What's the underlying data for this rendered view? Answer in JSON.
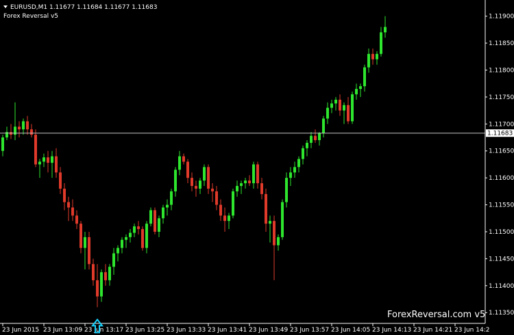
{
  "header": {
    "symbol_line": "EURUSD,M1  1.11677 1.11684 1.11677 1.11683",
    "indicator": "Forex Reversal v5"
  },
  "watermark": "ForexReversal.com v5",
  "colors": {
    "background": "#000000",
    "bull": "#2ee62e",
    "bear": "#e03a2a",
    "axis": "#ffffff",
    "arrow": "#19d3ff",
    "price_line": "#c8c8c8"
  },
  "chart_data": {
    "type": "candlestick",
    "symbol": "EURUSD",
    "timeframe": "M1",
    "ylim": [
      1.1133,
      1.1193
    ],
    "y_ticks": [
      "1.11900",
      "1.11850",
      "1.11800",
      "1.11750",
      "1.11700",
      "1.11650",
      "1.11600",
      "1.11550",
      "1.11500",
      "1.11450",
      "1.11400",
      "1.11350"
    ],
    "current_price": "1.11683",
    "x_labels": [
      "23 Jun 2015",
      "23 Jun 13:09",
      "23 Jun 13:17",
      "23 Jun 13:25",
      "23 Jun 13:33",
      "23 Jun 13:41",
      "23 Jun 13:49",
      "23 Jun 13:57",
      "23 Jun 14:05",
      "23 Jun 14:13",
      "23 Jun 14:21",
      "23 Jun 14:2"
    ],
    "x_label_candle_index": [
      0,
      10,
      20,
      30,
      40,
      50,
      60,
      70,
      80,
      90,
      100,
      110
    ],
    "candles": [
      {
        "o": 1.1165,
        "h": 1.1168,
        "l": 1.1164,
        "c": 1.11675
      },
      {
        "o": 1.11675,
        "h": 1.11695,
        "l": 1.1167,
        "c": 1.11685
      },
      {
        "o": 1.11685,
        "h": 1.117,
        "l": 1.11672,
        "c": 1.1168
      },
      {
        "o": 1.1168,
        "h": 1.1174,
        "l": 1.1167,
        "c": 1.11695
      },
      {
        "o": 1.11695,
        "h": 1.11705,
        "l": 1.11675,
        "c": 1.1169
      },
      {
        "o": 1.1169,
        "h": 1.1171,
        "l": 1.1168,
        "c": 1.11705
      },
      {
        "o": 1.11705,
        "h": 1.11715,
        "l": 1.1168,
        "c": 1.1169
      },
      {
        "o": 1.1169,
        "h": 1.117,
        "l": 1.11675,
        "c": 1.1168
      },
      {
        "o": 1.1168,
        "h": 1.1169,
        "l": 1.1162,
        "c": 1.11625
      },
      {
        "o": 1.11625,
        "h": 1.11635,
        "l": 1.116,
        "c": 1.1163
      },
      {
        "o": 1.1163,
        "h": 1.11645,
        "l": 1.1162,
        "c": 1.11638
      },
      {
        "o": 1.11638,
        "h": 1.1165,
        "l": 1.1161,
        "c": 1.11628
      },
      {
        "o": 1.11628,
        "h": 1.1165,
        "l": 1.116,
        "c": 1.1164
      },
      {
        "o": 1.1164,
        "h": 1.11655,
        "l": 1.116,
        "c": 1.1161
      },
      {
        "o": 1.1161,
        "h": 1.1162,
        "l": 1.1157,
        "c": 1.1158
      },
      {
        "o": 1.1158,
        "h": 1.1159,
        "l": 1.1154,
        "c": 1.11555
      },
      {
        "o": 1.11555,
        "h": 1.11565,
        "l": 1.1152,
        "c": 1.11545
      },
      {
        "o": 1.11545,
        "h": 1.1156,
        "l": 1.1152,
        "c": 1.1153
      },
      {
        "o": 1.1153,
        "h": 1.1154,
        "l": 1.11505,
        "c": 1.11515
      },
      {
        "o": 1.11515,
        "h": 1.1152,
        "l": 1.1146,
        "c": 1.1147
      },
      {
        "o": 1.1147,
        "h": 1.115,
        "l": 1.1143,
        "c": 1.1149
      },
      {
        "o": 1.1149,
        "h": 1.115,
        "l": 1.1143,
        "c": 1.1144
      },
      {
        "o": 1.1144,
        "h": 1.1145,
        "l": 1.114,
        "c": 1.1141
      },
      {
        "o": 1.1141,
        "h": 1.1144,
        "l": 1.1136,
        "c": 1.1138
      },
      {
        "o": 1.1138,
        "h": 1.1143,
        "l": 1.1137,
        "c": 1.11425
      },
      {
        "o": 1.11425,
        "h": 1.1144,
        "l": 1.114,
        "c": 1.1141
      },
      {
        "o": 1.1141,
        "h": 1.1144,
        "l": 1.114,
        "c": 1.11435
      },
      {
        "o": 1.11435,
        "h": 1.1147,
        "l": 1.1142,
        "c": 1.1146
      },
      {
        "o": 1.1146,
        "h": 1.11475,
        "l": 1.11445,
        "c": 1.1147
      },
      {
        "o": 1.1147,
        "h": 1.1149,
        "l": 1.1146,
        "c": 1.11485
      },
      {
        "o": 1.11485,
        "h": 1.11495,
        "l": 1.1147,
        "c": 1.1149
      },
      {
        "o": 1.1149,
        "h": 1.11505,
        "l": 1.1148,
        "c": 1.11498
      },
      {
        "o": 1.11498,
        "h": 1.11515,
        "l": 1.1149,
        "c": 1.1151
      },
      {
        "o": 1.1151,
        "h": 1.1152,
        "l": 1.11495,
        "c": 1.11505
      },
      {
        "o": 1.11505,
        "h": 1.1151,
        "l": 1.11465,
        "c": 1.1147
      },
      {
        "o": 1.1147,
        "h": 1.1152,
        "l": 1.1146,
        "c": 1.11515
      },
      {
        "o": 1.11515,
        "h": 1.11545,
        "l": 1.1151,
        "c": 1.1154
      },
      {
        "o": 1.1154,
        "h": 1.11545,
        "l": 1.11495,
        "c": 1.115
      },
      {
        "o": 1.115,
        "h": 1.1153,
        "l": 1.1149,
        "c": 1.11525
      },
      {
        "o": 1.11525,
        "h": 1.1155,
        "l": 1.11515,
        "c": 1.11545
      },
      {
        "o": 1.11545,
        "h": 1.1156,
        "l": 1.1153,
        "c": 1.1155
      },
      {
        "o": 1.1155,
        "h": 1.1158,
        "l": 1.1154,
        "c": 1.11575
      },
      {
        "o": 1.11575,
        "h": 1.1162,
        "l": 1.11565,
        "c": 1.11615
      },
      {
        "o": 1.11615,
        "h": 1.1165,
        "l": 1.11605,
        "c": 1.1164
      },
      {
        "o": 1.1164,
        "h": 1.11645,
        "l": 1.11625,
        "c": 1.1163
      },
      {
        "o": 1.1163,
        "h": 1.11635,
        "l": 1.1159,
        "c": 1.116
      },
      {
        "o": 1.116,
        "h": 1.1161,
        "l": 1.11575,
        "c": 1.11585
      },
      {
        "o": 1.11585,
        "h": 1.11595,
        "l": 1.11565,
        "c": 1.1158
      },
      {
        "o": 1.1158,
        "h": 1.116,
        "l": 1.1157,
        "c": 1.11595
      },
      {
        "o": 1.11595,
        "h": 1.11625,
        "l": 1.11585,
        "c": 1.1162
      },
      {
        "o": 1.1162,
        "h": 1.11625,
        "l": 1.1157,
        "c": 1.1158
      },
      {
        "o": 1.1158,
        "h": 1.1159,
        "l": 1.11555,
        "c": 1.11575
      },
      {
        "o": 1.11575,
        "h": 1.11585,
        "l": 1.1154,
        "c": 1.1155
      },
      {
        "o": 1.1155,
        "h": 1.1156,
        "l": 1.1152,
        "c": 1.1153
      },
      {
        "o": 1.1153,
        "h": 1.11545,
        "l": 1.115,
        "c": 1.1152
      },
      {
        "o": 1.1152,
        "h": 1.11535,
        "l": 1.11505,
        "c": 1.1153
      },
      {
        "o": 1.1153,
        "h": 1.1158,
        "l": 1.11525,
        "c": 1.11575
      },
      {
        "o": 1.11575,
        "h": 1.11595,
        "l": 1.11565,
        "c": 1.11585
      },
      {
        "o": 1.11585,
        "h": 1.11595,
        "l": 1.1157,
        "c": 1.1159
      },
      {
        "o": 1.1159,
        "h": 1.116,
        "l": 1.1158,
        "c": 1.11595
      },
      {
        "o": 1.11595,
        "h": 1.11605,
        "l": 1.11585,
        "c": 1.1159
      },
      {
        "o": 1.1159,
        "h": 1.1163,
        "l": 1.1158,
        "c": 1.11625
      },
      {
        "o": 1.11625,
        "h": 1.1163,
        "l": 1.1158,
        "c": 1.1159
      },
      {
        "o": 1.1159,
        "h": 1.116,
        "l": 1.1156,
        "c": 1.1157
      },
      {
        "o": 1.1157,
        "h": 1.1158,
        "l": 1.115,
        "c": 1.11515
      },
      {
        "o": 1.11515,
        "h": 1.1153,
        "l": 1.1148,
        "c": 1.1152
      },
      {
        "o": 1.1152,
        "h": 1.1153,
        "l": 1.1141,
        "c": 1.11475
      },
      {
        "o": 1.11475,
        "h": 1.11495,
        "l": 1.11465,
        "c": 1.1149
      },
      {
        "o": 1.1149,
        "h": 1.1156,
        "l": 1.11485,
        "c": 1.11555
      },
      {
        "o": 1.11555,
        "h": 1.1161,
        "l": 1.11545,
        "c": 1.116
      },
      {
        "o": 1.116,
        "h": 1.1162,
        "l": 1.11585,
        "c": 1.1161
      },
      {
        "o": 1.1161,
        "h": 1.1163,
        "l": 1.116,
        "c": 1.1162
      },
      {
        "o": 1.1162,
        "h": 1.1164,
        "l": 1.1161,
        "c": 1.11635
      },
      {
        "o": 1.11635,
        "h": 1.1166,
        "l": 1.11625,
        "c": 1.11655
      },
      {
        "o": 1.11655,
        "h": 1.1167,
        "l": 1.1164,
        "c": 1.11665
      },
      {
        "o": 1.11665,
        "h": 1.11685,
        "l": 1.11655,
        "c": 1.11678
      },
      {
        "o": 1.11678,
        "h": 1.1169,
        "l": 1.11665,
        "c": 1.1167
      },
      {
        "o": 1.1167,
        "h": 1.11685,
        "l": 1.1166,
        "c": 1.11683
      },
      {
        "o": 1.11683,
        "h": 1.11715,
        "l": 1.11675,
        "c": 1.1171
      },
      {
        "o": 1.1171,
        "h": 1.1174,
        "l": 1.117,
        "c": 1.1173
      },
      {
        "o": 1.1173,
        "h": 1.11745,
        "l": 1.1172,
        "c": 1.11738
      },
      {
        "o": 1.11738,
        "h": 1.1175,
        "l": 1.11725,
        "c": 1.11745
      },
      {
        "o": 1.11745,
        "h": 1.11755,
        "l": 1.11715,
        "c": 1.11725
      },
      {
        "o": 1.11725,
        "h": 1.1174,
        "l": 1.117,
        "c": 1.11735
      },
      {
        "o": 1.11735,
        "h": 1.1175,
        "l": 1.117,
        "c": 1.11705
      },
      {
        "o": 1.11705,
        "h": 1.1176,
        "l": 1.117,
        "c": 1.11755
      },
      {
        "o": 1.11755,
        "h": 1.11775,
        "l": 1.11745,
        "c": 1.11765
      },
      {
        "o": 1.11765,
        "h": 1.11775,
        "l": 1.1175,
        "c": 1.1177
      },
      {
        "o": 1.1177,
        "h": 1.1181,
        "l": 1.1176,
        "c": 1.11805
      },
      {
        "o": 1.11805,
        "h": 1.1184,
        "l": 1.11795,
        "c": 1.1183
      },
      {
        "o": 1.1183,
        "h": 1.1184,
        "l": 1.1181,
        "c": 1.1182
      },
      {
        "o": 1.1182,
        "h": 1.11835,
        "l": 1.1181,
        "c": 1.1183
      },
      {
        "o": 1.1183,
        "h": 1.1188,
        "l": 1.11825,
        "c": 1.1187
      },
      {
        "o": 1.1187,
        "h": 1.119,
        "l": 1.1186,
        "c": 1.1188
      }
    ],
    "signals": [
      {
        "type": "buy-arrow",
        "candle_index": 23
      }
    ]
  }
}
